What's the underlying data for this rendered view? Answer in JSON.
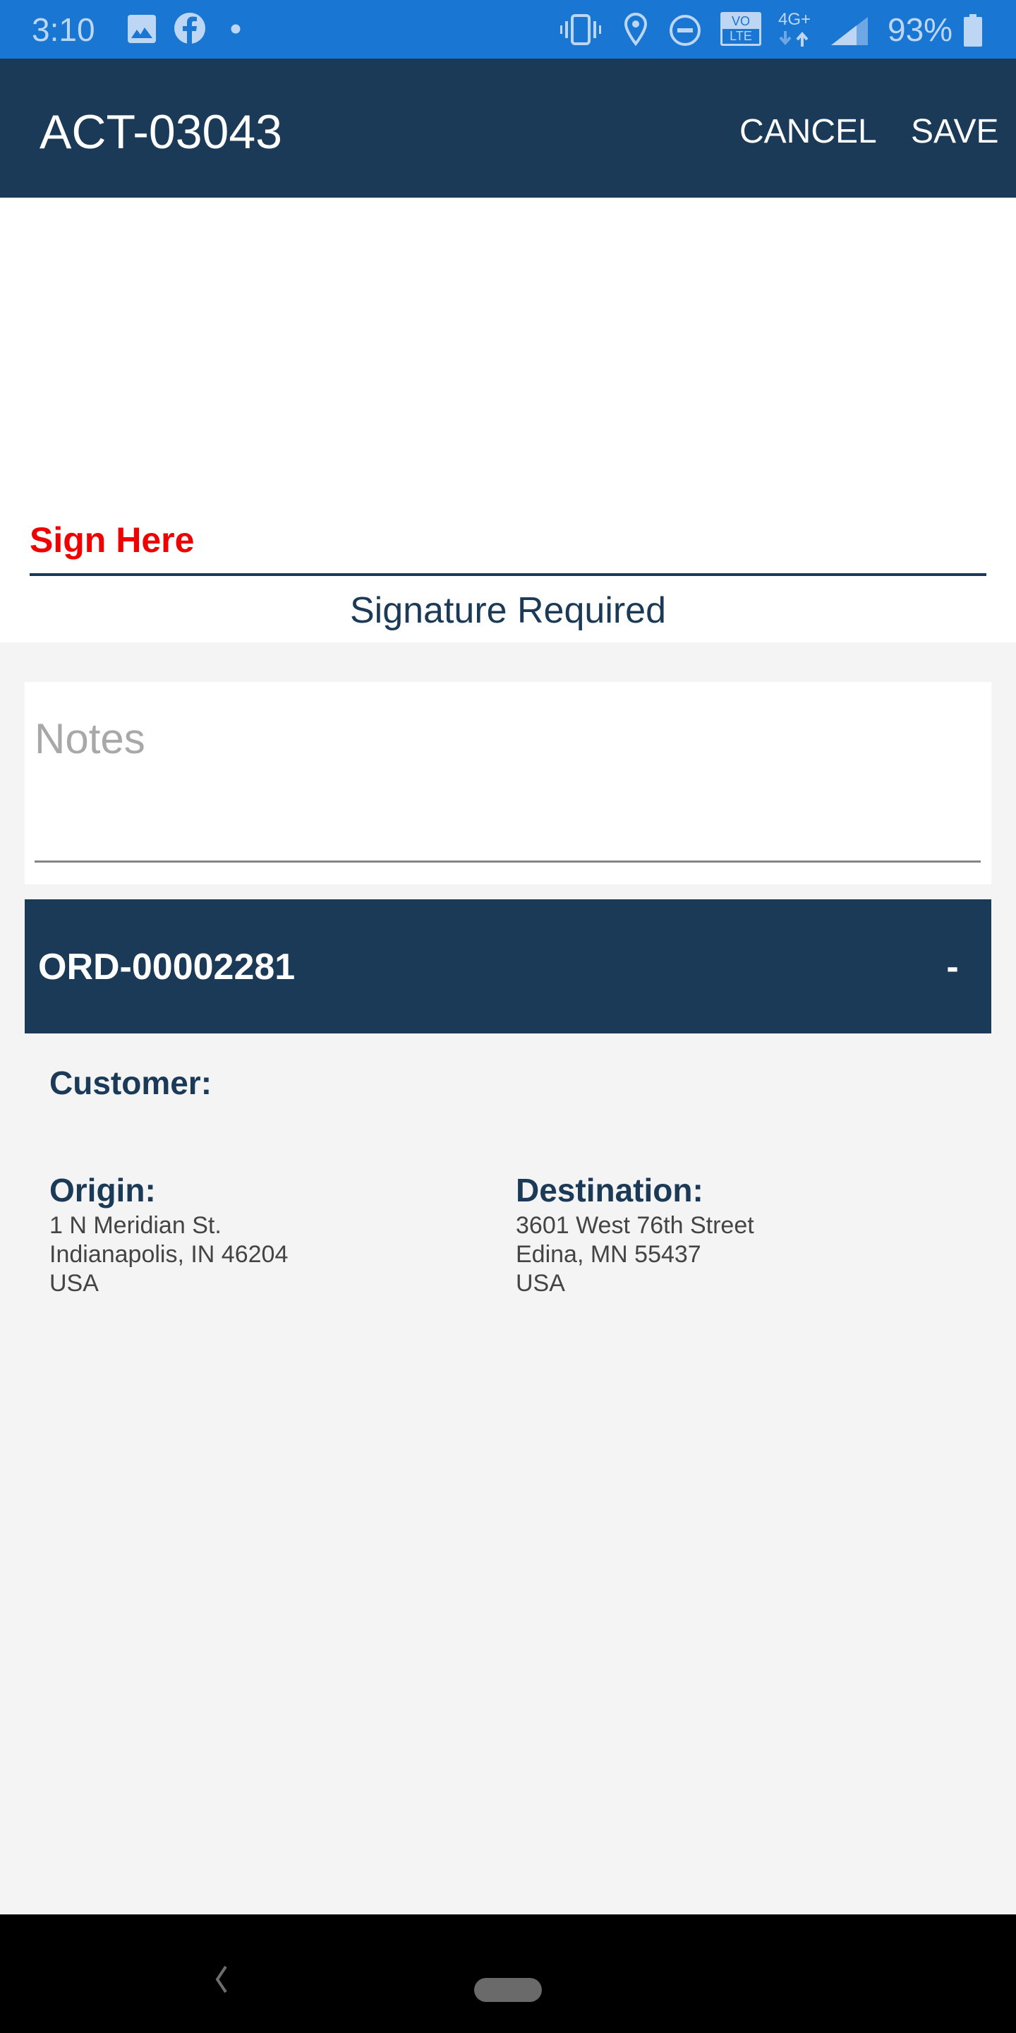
{
  "status_bar": {
    "time": "3:10",
    "left_icons": [
      "gallery-icon",
      "facebook-icon",
      "notification-dot-icon"
    ],
    "right_icons": [
      "vibrate-icon",
      "location-icon",
      "do-not-disturb-icon",
      "volte-icon",
      "network-4g-plus-icon",
      "signal-icon",
      "battery-icon"
    ],
    "volte_top": "VO",
    "volte_bottom": "LTE",
    "network": "4G+",
    "battery": "93%",
    "colors": {
      "background": "#1976d2",
      "foreground": "#bcd6f3"
    }
  },
  "app_bar": {
    "title": "ACT-03043",
    "cancel_label": "CANCEL",
    "save_label": "SAVE",
    "background": "#1b3a57"
  },
  "signature": {
    "prompt": "Sign Here",
    "prompt_color": "#f10000",
    "status": "Signature Required"
  },
  "notes": {
    "value": "",
    "placeholder": "Notes"
  },
  "order": {
    "id": "ORD-00002281",
    "toggle": "-",
    "customer_label": "Customer:",
    "customer_value": "",
    "origin": {
      "label": "Origin:",
      "line1": "1 N Meridian St.",
      "line2": "Indianapolis, IN 46204",
      "line3": "USA"
    },
    "destination": {
      "label": "Destination:",
      "line1": "3601 West 76th Street",
      "line2": "Edina, MN 55437",
      "line3": "USA"
    }
  },
  "nav_bar": {
    "icons": [
      "back-icon",
      "home-pill-icon"
    ]
  }
}
